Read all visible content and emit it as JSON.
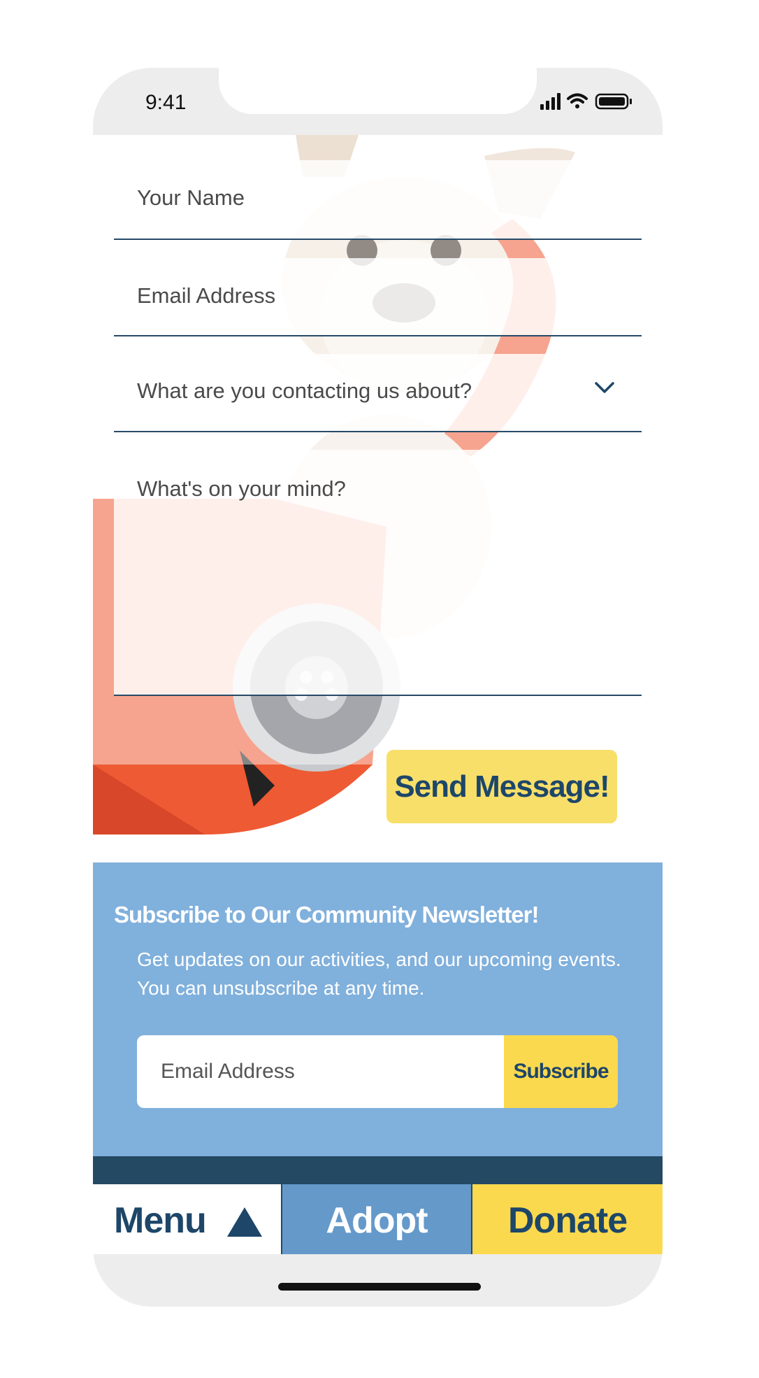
{
  "status_bar": {
    "time": "9:41",
    "icons": [
      "signal-icon",
      "wifi-icon",
      "battery-icon"
    ]
  },
  "contact_form": {
    "name_placeholder": "Your Name",
    "email_placeholder": "Email Address",
    "topic_placeholder": "What are you contacting us about?",
    "message_placeholder": "What's on your mind?",
    "send_label": "Send Message!"
  },
  "newsletter": {
    "title": "Subscribe to Our Community Newsletter!",
    "description": "Get updates on our activities, and our upcoming events. You can unsubscribe at any time.",
    "email_placeholder": "Email Address",
    "subscribe_label": "Subscribe"
  },
  "bottom_nav": {
    "menu_label": "Menu",
    "adopt_label": "Adopt",
    "donate_label": "Donate"
  },
  "colors": {
    "navy": "#1d4669",
    "yellow": "#fbd94e",
    "light_blue": "#80b0dc",
    "blue": "#6499ca",
    "phone_red": "#ee5a33"
  }
}
